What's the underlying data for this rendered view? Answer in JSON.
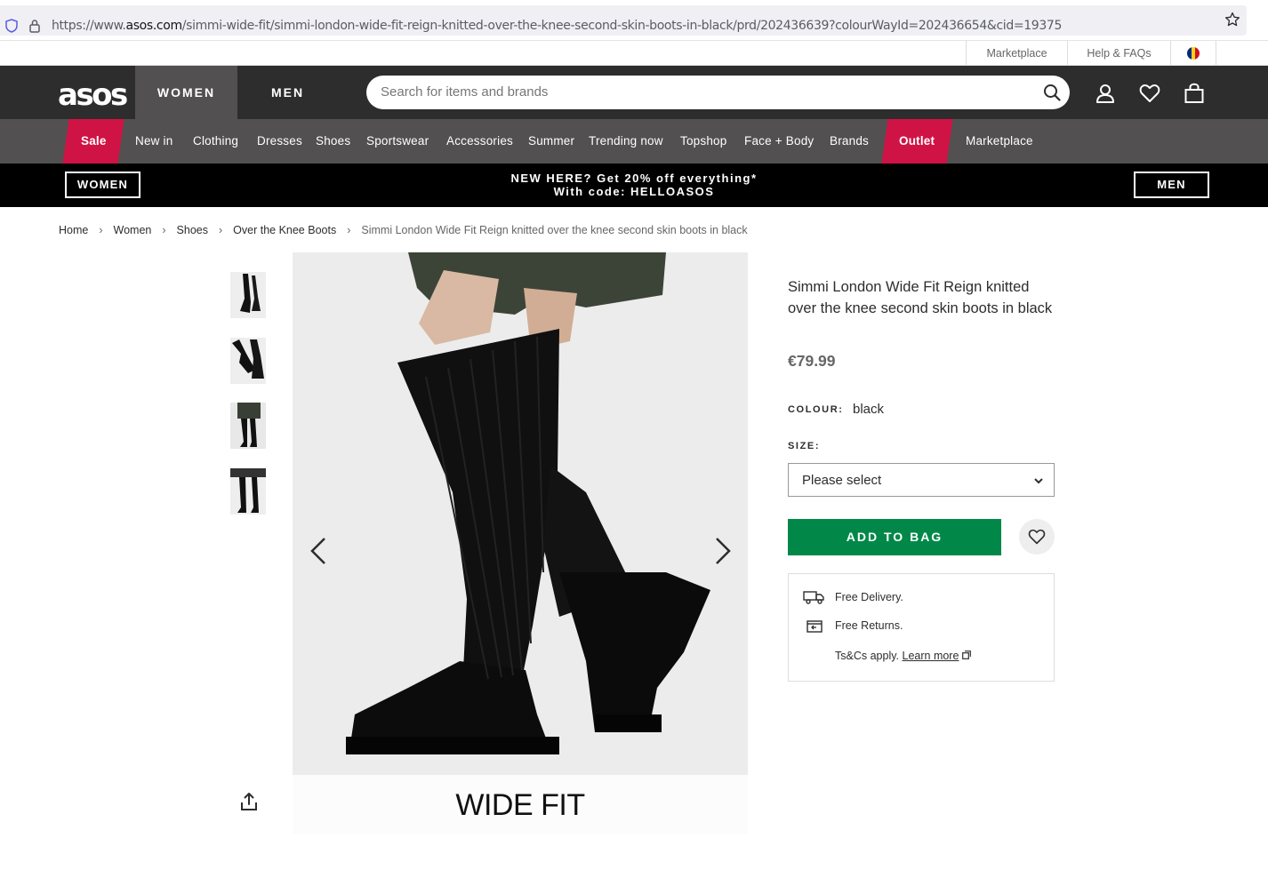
{
  "browser": {
    "url_prefix": "https://www.",
    "url_domain": "asos.com",
    "url_path": "/simmi-wide-fit/simmi-london-wide-fit-reign-knitted-over-the-knee-second-skin-boots-in-black/prd/202436639?colourWayId=202436654&cid=19375"
  },
  "utility": {
    "marketplace": "Marketplace",
    "help": "Help & FAQs"
  },
  "header": {
    "logo": "asos",
    "tab_women": "WOMEN",
    "tab_men": "MEN",
    "search_placeholder": "Search for items and brands"
  },
  "nav": {
    "items": [
      "Sale",
      "New in",
      "Clothing",
      "Dresses",
      "Shoes",
      "Sportswear",
      "Accessories",
      "Summer",
      "Trending now",
      "Topshop",
      "Face + Body",
      "Brands",
      "Outlet",
      "Marketplace"
    ]
  },
  "promo": {
    "women_btn": "WOMEN",
    "men_btn": "MEN",
    "line1": "NEW HERE? Get 20% off everything*",
    "line2": "With code: HELLOASOS"
  },
  "breadcrumb": [
    "Home",
    "Women",
    "Shoes",
    "Over the Knee Boots",
    "Simmi London Wide Fit Reign knitted over the knee second skin boots in black"
  ],
  "product": {
    "title": "Simmi London Wide Fit Reign knitted over the knee second skin boots in black",
    "price": "€79.99",
    "colour_label": "COLOUR:",
    "colour_value": "black",
    "size_label": "SIZE:",
    "size_value": "Please select",
    "add_to_bag": "ADD TO BAG",
    "image_caption": "WIDE FIT"
  },
  "delivery": {
    "free_delivery": "Free Delivery.",
    "free_returns": "Free Returns.",
    "tcs": "Ts&Cs apply.",
    "learn_more": "Learn more"
  },
  "colors": {
    "header": "#2d2d2d",
    "nav": "#525050",
    "sale_red": "#d01345",
    "add_green": "#018849"
  }
}
